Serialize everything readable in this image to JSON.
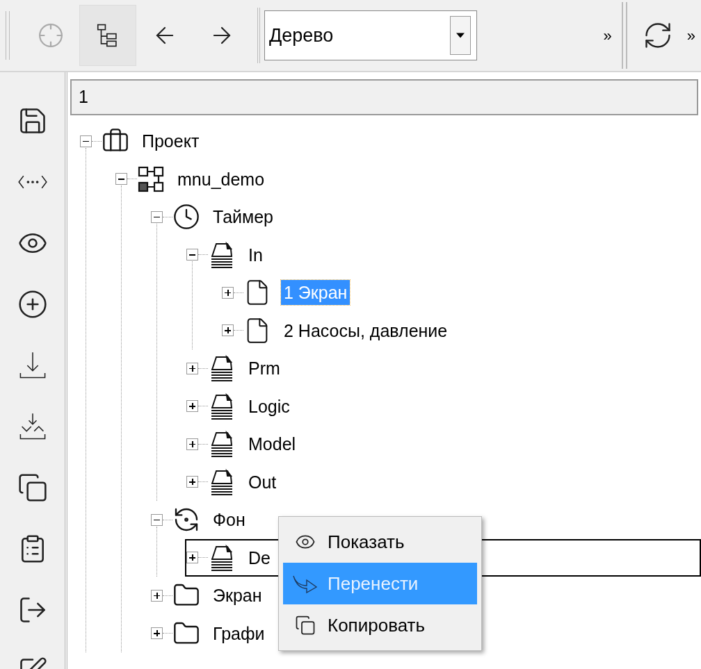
{
  "toolbar": {
    "buttons": [
      {
        "kind": "target",
        "disabled": true,
        "selected": false
      },
      {
        "kind": "tree",
        "disabled": false,
        "selected": true
      },
      {
        "kind": "back",
        "disabled": false,
        "selected": false
      },
      {
        "kind": "forward",
        "disabled": false,
        "selected": false
      }
    ],
    "view_select": {
      "value": "Дерево"
    },
    "overflow": "»",
    "refresh_overflow": "»"
  },
  "path_field": {
    "value": "1"
  },
  "tree": [
    {
      "label": "Проект",
      "kind": "briefcase",
      "expanded": true,
      "selected": false,
      "outlined": false,
      "children": [
        {
          "label": "mnu_demo",
          "kind": "diagram",
          "expanded": true,
          "selected": false,
          "outlined": false,
          "children": [
            {
              "label": "Таймер",
              "kind": "clock",
              "expanded": true,
              "selected": false,
              "outlined": false,
              "children": [
                {
                  "label": "In",
                  "kind": "stack",
                  "expanded": true,
                  "selected": false,
                  "outlined": false,
                  "children": [
                    {
                      "label": "1 Экран",
                      "kind": "page",
                      "expanded": false,
                      "selected": true,
                      "outlined": false
                    },
                    {
                      "label": "2 Насосы, давление",
                      "kind": "page",
                      "expanded": false,
                      "selected": false,
                      "outlined": false
                    }
                  ]
                },
                {
                  "label": "Prm",
                  "kind": "stack",
                  "expanded": false,
                  "selected": false,
                  "outlined": false
                },
                {
                  "label": "Logic",
                  "kind": "stack",
                  "expanded": false,
                  "selected": false,
                  "outlined": false
                },
                {
                  "label": "Model",
                  "kind": "stack",
                  "expanded": false,
                  "selected": false,
                  "outlined": false
                },
                {
                  "label": "Out",
                  "kind": "stack",
                  "expanded": false,
                  "selected": false,
                  "outlined": false
                }
              ]
            },
            {
              "label": "Фон",
              "kind": "cycle",
              "expanded": true,
              "selected": false,
              "outlined": false,
              "children": [
                {
                  "label": "De",
                  "kind": "stack",
                  "expanded": false,
                  "selected": false,
                  "outlined": true
                }
              ]
            },
            {
              "label": "Экран",
              "kind": "folder",
              "expanded": false,
              "selected": false,
              "outlined": false
            },
            {
              "label": "Графи",
              "kind": "folder",
              "expanded": false,
              "selected": false,
              "outlined": false
            }
          ]
        }
      ]
    }
  ],
  "context_menu": {
    "items": [
      {
        "label": "Показать",
        "kind": "eye",
        "selected": false
      },
      {
        "label": "Перенести",
        "kind": "move",
        "selected": true
      },
      {
        "label": "Копировать",
        "kind": "copy",
        "selected": false
      }
    ]
  }
}
